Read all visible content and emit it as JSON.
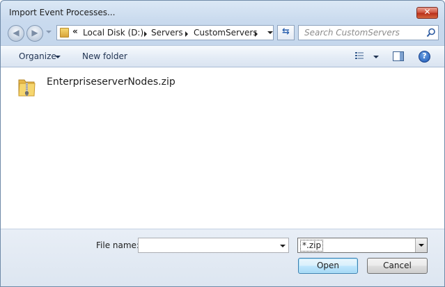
{
  "window": {
    "title": "Import Event Processes...",
    "close_glyph": "✕"
  },
  "nav": {
    "back_glyph": "◀",
    "forward_glyph": "▶",
    "address_overflow": "«",
    "breadcrumbs": [
      "Local Disk (D:)",
      "Servers",
      "CustomServers"
    ],
    "refresh_glyph": "⇆",
    "search_placeholder": "Search CustomServers"
  },
  "toolbar": {
    "organize_label": "Organize",
    "new_folder_label": "New folder",
    "help_glyph": "?"
  },
  "files": [
    {
      "name": "EnterpriseserverNodes.zip",
      "icon": "zip-folder-icon"
    }
  ],
  "bottom": {
    "file_name_label": "File name:",
    "file_name_value": "",
    "filter_value": "*.zip",
    "open_label": "Open",
    "cancel_label": "Cancel"
  },
  "colors": {
    "accent": "#3c7fb1",
    "close": "#c7432c"
  }
}
